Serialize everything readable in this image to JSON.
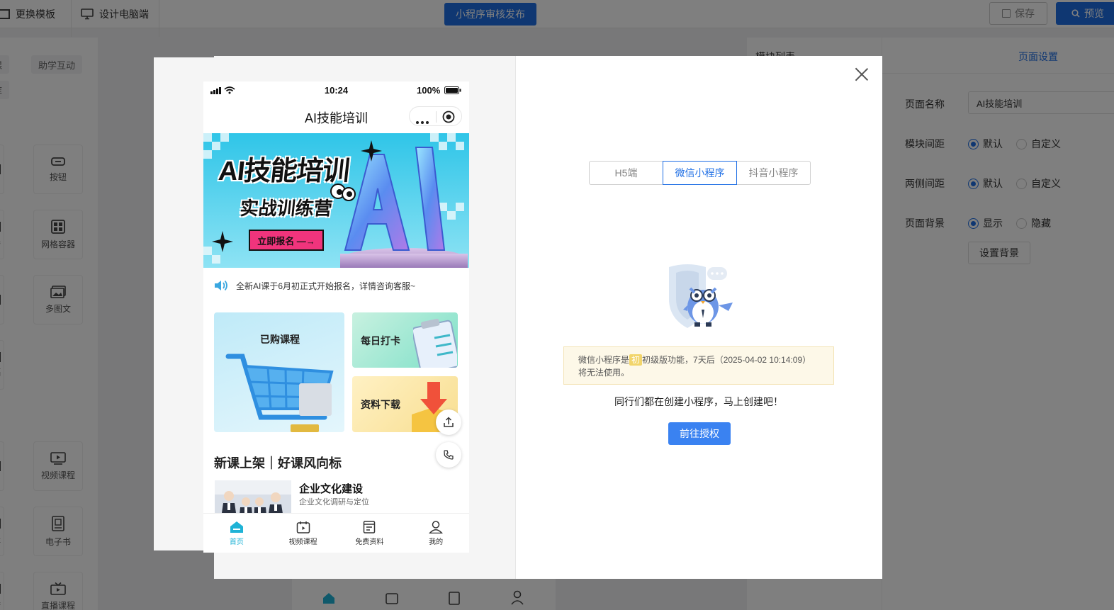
{
  "toolbar": {
    "change_template": "更换模板",
    "design_pc": "设计电脑端",
    "publish": "小程序审核发布",
    "save": "保存",
    "preview": "预览"
  },
  "left_panel": {
    "tags": [
      "助学互动"
    ],
    "components": [
      "按钮",
      "网格容器",
      "多图文",
      "视频课程",
      "电子书",
      "直播课程"
    ]
  },
  "right_panel": {
    "module_tab": "模块列表",
    "page_settings_tab": "页面设置",
    "page_name_label": "页面名称",
    "page_name_value": "AI技能培训",
    "module_spacing_label": "模块间距",
    "side_spacing_label": "两侧间距",
    "page_bg_label": "页面背景",
    "option_default": "默认",
    "option_custom": "自定义",
    "option_show": "显示",
    "option_hide": "隐藏",
    "set_bg": "设置背景"
  },
  "phone": {
    "time": "10:24",
    "battery": "100%",
    "title": "AI技能培训",
    "banner": {
      "headline": "AI技能培训",
      "subline": "实战训练营",
      "cta": "立即报名 —→",
      "big_letters": "AI"
    },
    "notice": "全新AI课于6月初正式开始报名，详情咨询客服~",
    "cards": {
      "purchased": "已购课程",
      "checkin": "每日打卡",
      "download": "资料下载"
    },
    "section_title": "新课上架｜好课风向标",
    "course": {
      "title": "企业文化建设",
      "subtitle": "企业文化调研与定位"
    },
    "tabs": [
      "首页",
      "视频课程",
      "免费资料",
      "我的"
    ]
  },
  "modal": {
    "platforms": [
      "H5端",
      "微信小程序",
      "抖音小程序"
    ],
    "active_platform": "微信小程序",
    "warning_prefix": "微信小程序是",
    "warning_badge": "初",
    "warning_text": "初级版功能，7天后（2025-04-02 10:14:09）将无法使用。",
    "invite": "同行们都在创建小程序，马上创建吧！",
    "auth_button": "前往授权"
  },
  "colors": {
    "primary": "#1f6fe5",
    "auth_button": "#3a82f1",
    "tab_active": "#1fb3d6",
    "warning_bg": "#fdf8e8",
    "cta_pink": "#f0347c"
  }
}
